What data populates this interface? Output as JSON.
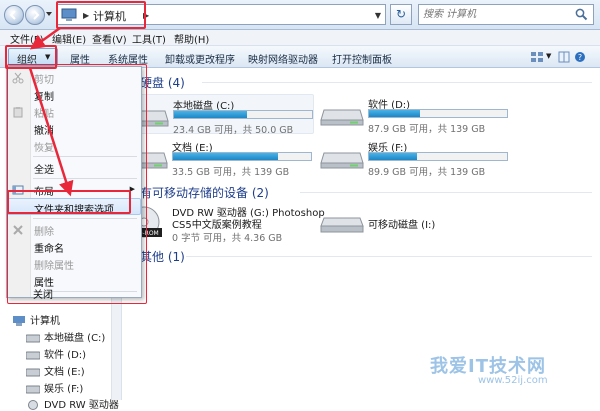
{
  "address": {
    "crumb": "计算机",
    "search_placeholder": "搜索 计算机"
  },
  "menubar": {
    "items": [
      "文件(F)",
      "编辑(E)",
      "查看(V)",
      "工具(T)",
      "帮助(H)"
    ]
  },
  "commandbar": {
    "organize": "组织",
    "items": [
      "属性",
      "系统属性",
      "卸载或更改程序",
      "映射网络驱动器",
      "打开控制面板"
    ]
  },
  "dropdown": {
    "items": [
      {
        "label": "剪切",
        "disabled": true
      },
      {
        "label": "复制",
        "disabled": false
      },
      {
        "label": "粘贴",
        "disabled": true
      },
      {
        "label": "撤消",
        "disabled": false
      },
      {
        "label": "恢复",
        "disabled": true
      },
      {
        "label": "全选",
        "disabled": false
      },
      {
        "label": "布局",
        "disabled": false
      },
      {
        "label": "文件夹和搜索选项",
        "disabled": false
      },
      {
        "label": "删除",
        "disabled": true
      },
      {
        "label": "重命名",
        "disabled": false
      },
      {
        "label": "删除属性",
        "disabled": true
      },
      {
        "label": "属性",
        "disabled": false
      },
      {
        "label": "关闭",
        "disabled": false
      }
    ]
  },
  "content": {
    "hard_disk_header": "硬盘 (4)",
    "removable_header": "有可移动存储的设备 (2)",
    "other_header": "其他 (1)",
    "drives": [
      {
        "name": "本地磁盘 (C:)",
        "size": "23.4 GB 可用，共 50.0 GB",
        "used_fraction": 0.53
      },
      {
        "name": "软件 (D:)",
        "size": "87.9 GB 可用，共 139 GB",
        "used_fraction": 0.37
      },
      {
        "name": "文档 (E:)",
        "size": "33.5 GB 可用，共 139 GB",
        "used_fraction": 0.76
      },
      {
        "name": "娱乐 (F:)",
        "size": "89.9 GB 可用，共 139 GB",
        "used_fraction": 0.35
      }
    ],
    "dvd": {
      "name_line1": "DVD RW 驱动器 (G:) Photoshop",
      "name_line2": "CS5中文版案例教程",
      "size": "0 字节 可用，共 4.36 GB",
      "badge": "DVD-ROM"
    },
    "removable": {
      "name": "可移动磁盘 (I:)"
    }
  },
  "navpane": {
    "root": "计算机",
    "items": [
      "本地磁盘 (C:)",
      "软件 (D:)",
      "文档 (E:)",
      "娱乐 (F:)",
      "DVD RW 驱动器"
    ]
  },
  "watermark": {
    "brand": "我爱IT技术网",
    "url": "www.52ij.com"
  },
  "colors": {
    "annotation": "#e8283a",
    "group_header": "#1e3e8a",
    "drive_bar": "#1d86c6"
  }
}
